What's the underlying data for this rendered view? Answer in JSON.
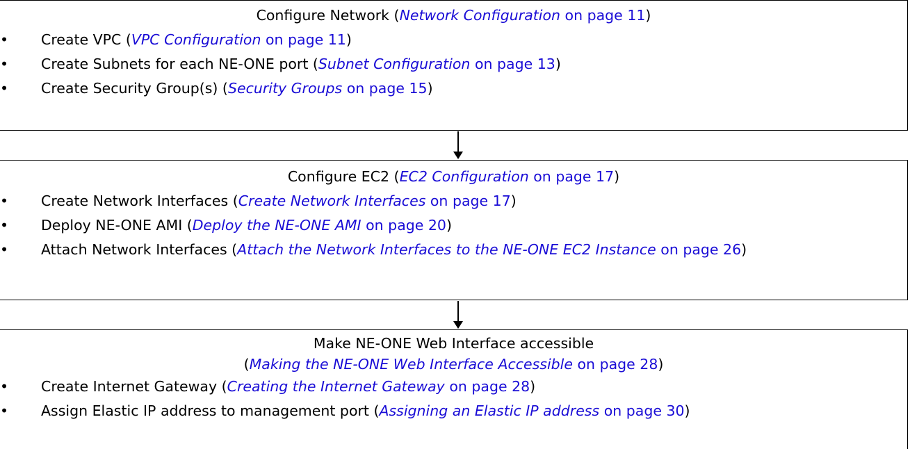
{
  "boxes": [
    {
      "title": {
        "text": "Configure Network (",
        "link_italic": "Network Configuration",
        "link_rest": " on page 11",
        "suffix": ")"
      },
      "items": [
        {
          "bullet": "•",
          "text": "Create VPC (",
          "link_italic": "VPC Configuration",
          "link_rest": " on page 11",
          "suffix": ")"
        },
        {
          "bullet": "•",
          "text": "Create Subnets for each NE-ONE port (",
          "link_italic": "Subnet Configuration",
          "link_rest": " on page 13",
          "suffix": ")"
        },
        {
          "bullet": "•",
          "text": "Create Security Group(s) (",
          "link_italic": "Security Groups",
          "link_rest": " on page 15",
          "suffix": ")"
        }
      ]
    },
    {
      "title": {
        "text": "Configure EC2 (",
        "link_italic": "EC2 Configuration",
        "link_rest": " on page 17",
        "suffix": ")"
      },
      "items": [
        {
          "bullet": "•",
          "text": "Create Network Interfaces (",
          "link_italic": "Create Network Interfaces",
          "link_rest": " on page 17",
          "suffix": ")"
        },
        {
          "bullet": "•",
          "text": "Deploy NE-ONE AMI (",
          "link_italic": "Deploy the NE-ONE AMI",
          "link_rest": " on page 20",
          "suffix": ")"
        },
        {
          "bullet": "•",
          "text": "Attach Network Interfaces (",
          "link_italic": "Attach the Network Interfaces to the NE-ONE EC2 Instance",
          "link_rest": " on page 26",
          "suffix": ")"
        }
      ]
    },
    {
      "title": {
        "line1": "Make NE-ONE Web Interface accessible",
        "text": "(",
        "link_italic": "Making the NE-ONE Web Interface Accessible",
        "link_rest": " on page 28",
        "suffix": ")"
      },
      "items": [
        {
          "bullet": "•",
          "text": "Create Internet Gateway (",
          "link_italic": "Creating the Internet Gateway",
          "link_rest": " on page 28",
          "suffix": ")"
        },
        {
          "bullet": "•",
          "text": "Assign Elastic IP address to management port (",
          "link_italic": "Assigning an Elastic IP address",
          "link_rest": " on page 30",
          "suffix": ")"
        }
      ]
    }
  ]
}
